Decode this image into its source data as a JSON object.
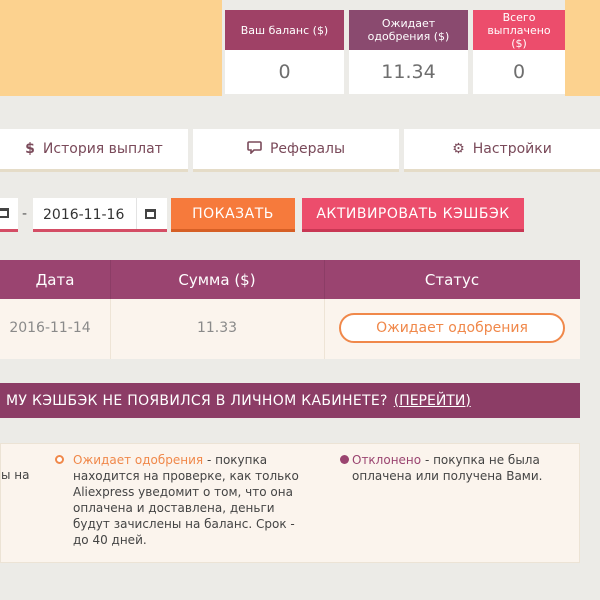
{
  "colors": {
    "header_yellow": "#fcd28f",
    "card1_head": "#9f4166",
    "card2_head": "#8a4a6f",
    "card3_head": "#ec4d6c",
    "show_button": "#f67a3c",
    "activate_button": "#ec4d6c",
    "table_head": "#9a4470",
    "pending_orange": "#f0884a"
  },
  "stats": {
    "balance_label": "Ваш баланс ($)",
    "balance_value": "0",
    "pending_label": "Ожидает одобрения ($)",
    "pending_value": "11.34",
    "paid_label": "Всего выплачено ($)",
    "paid_value": "0"
  },
  "tabs": [
    {
      "icon": "dollar-icon",
      "label": "История выплат"
    },
    {
      "icon": "chat-icon",
      "label": "Рефералы"
    },
    {
      "icon": "gear-icon",
      "label": "Настройки"
    }
  ],
  "filter": {
    "date_separator": "-",
    "date_to": "2016-11-16",
    "show_label": "ПОКАЗАТЬ",
    "activate_label": "АКТИВИРОВАТЬ КЭШБЭК"
  },
  "table": {
    "headers": [
      "Дата",
      "Сумма ($)",
      "Статус"
    ],
    "rows": [
      {
        "date": "2016-11-14",
        "amount": "11.33",
        "status": "Ожидает одобрения"
      }
    ]
  },
  "banner": {
    "text": "МУ КЭШБЭК НЕ ПОЯВИЛСЯ В ЛИЧНОМ КАБИНЕТЕ?",
    "link": "(ПЕРЕЙТИ)"
  },
  "legend": {
    "left_fragment": "ы на",
    "pending_title": "Ожидает одобрения",
    "pending_desc": " - покупка находится на проверке, как только Aliexpress уведомит о том, что она оплачена и доставлена, деньги будут зачислены на баланс. Срок - до 40 дней.",
    "rejected_title": "Отклонено",
    "rejected_desc": " - покупка не была оплачена или получена Вами."
  }
}
